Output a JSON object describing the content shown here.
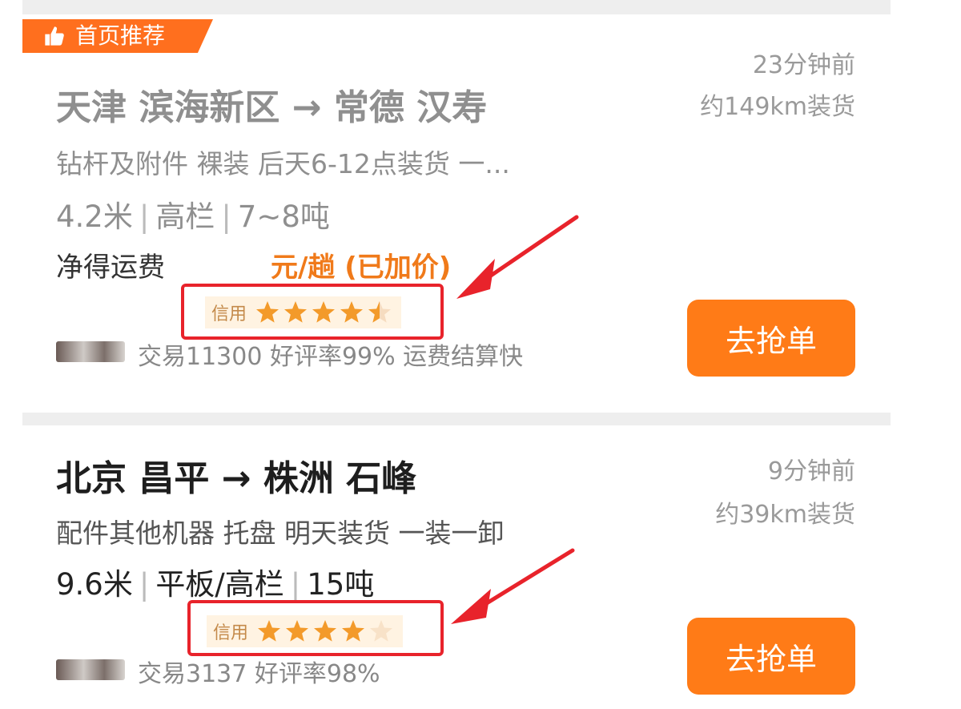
{
  "colors": {
    "accent": "#ff7b17",
    "highlight_box": "#e8232b",
    "star": "#f39a2a"
  },
  "cards": [
    {
      "badge": "首页推荐",
      "route": "天津 滨海新区 → 常德 汉寿",
      "description": "钻杆及附件 裸装 后天6-12点装货 一...",
      "spec": {
        "length": "4.2米",
        "type": "高栏",
        "weight": "7~8吨"
      },
      "time": "23分钟前",
      "distance": "约149km装货",
      "price_label": "净得运费",
      "price": "元/趟 (已加价)",
      "credit_label": "信用",
      "credit_stars": 4.5,
      "stats": "交易11300 好评率99% 运费结算快",
      "button": "去抢单"
    },
    {
      "route": "北京 昌平 → 株洲 石峰",
      "description": "配件其他机器 托盘 明天装货 一装一卸",
      "spec": {
        "length": "9.6米",
        "type": "平板/高栏",
        "weight": "15吨"
      },
      "time": "9分钟前",
      "distance": "约39km装货",
      "credit_label": "信用",
      "credit_stars": 4,
      "stats": "交易3137 好评率98%",
      "button": "去抢单"
    }
  ]
}
